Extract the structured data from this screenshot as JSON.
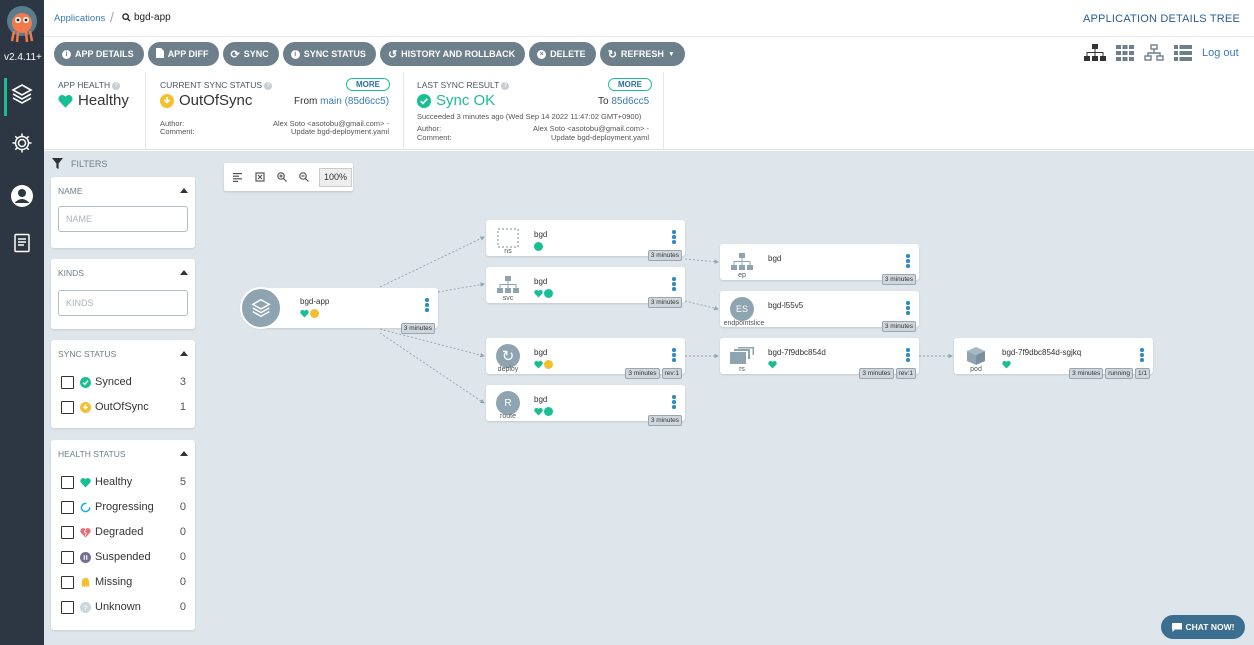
{
  "sidebar": {
    "version": "v2.4.11+"
  },
  "header": {
    "breadcrumb_root": "Applications",
    "breadcrumb_current": "bgd-app",
    "title": "APPLICATION DETAILS TREE"
  },
  "toolbar": {
    "buttons": [
      {
        "label": "APP DETAILS",
        "icon": "info-icon"
      },
      {
        "label": "APP DIFF",
        "icon": "file-icon"
      },
      {
        "label": "SYNC",
        "icon": "sync-icon"
      },
      {
        "label": "SYNC STATUS",
        "icon": "info-icon"
      },
      {
        "label": "HISTORY AND ROLLBACK",
        "icon": "history-icon"
      },
      {
        "label": "DELETE",
        "icon": "delete-icon"
      },
      {
        "label": "REFRESH",
        "icon": "refresh-icon"
      }
    ],
    "logout": "Log out"
  },
  "status": {
    "health": {
      "label": "APP HEALTH",
      "value": "Healthy"
    },
    "sync": {
      "label": "CURRENT SYNC STATUS",
      "value": "OutOfSync",
      "more": "MORE",
      "from_prefix": "From",
      "from_link": "main (85d6cc5)",
      "author_label": "Author:",
      "author": "Alex Soto <asotobu@gmail.com> -",
      "comment_label": "Comment:",
      "comment": "Update bgd-deployment.yaml"
    },
    "last_sync": {
      "label": "LAST SYNC RESULT",
      "value": "Sync OK",
      "more": "MORE",
      "to_prefix": "To",
      "to_link": "85d6cc5",
      "succeeded": "Succeeded 3 minutes ago (Wed Sep 14 2022 11:47:02 GMT+0900)",
      "author_label": "Author:",
      "author": "Alex Soto <asotobu@gmail.com> -",
      "comment_label": "Comment:",
      "comment": "Update bgd-deployment.yaml"
    }
  },
  "filters": {
    "title": "FILTERS",
    "name": {
      "title": "NAME",
      "placeholder": "NAME"
    },
    "kinds": {
      "title": "KINDS",
      "placeholder": "KINDS"
    },
    "sync_status": {
      "title": "SYNC STATUS",
      "items": [
        {
          "label": "Synced",
          "count": "3"
        },
        {
          "label": "OutOfSync",
          "count": "1"
        }
      ]
    },
    "health_status": {
      "title": "HEALTH STATUS",
      "items": [
        {
          "label": "Healthy",
          "count": "5"
        },
        {
          "label": "Progressing",
          "count": "0"
        },
        {
          "label": "Degraded",
          "count": "0"
        },
        {
          "label": "Suspended",
          "count": "0"
        },
        {
          "label": "Missing",
          "count": "0"
        },
        {
          "label": "Unknown",
          "count": "0"
        }
      ]
    }
  },
  "graph": {
    "zoom": "100%",
    "nodes": {
      "app": {
        "name": "bgd-app",
        "kind": "",
        "tags": [
          "3 minutes"
        ]
      },
      "ns": {
        "name": "bgd",
        "kind": "ns",
        "tags": [
          "3 minutes"
        ]
      },
      "svc": {
        "name": "bgd",
        "kind": "svc",
        "tags": [
          "3 minutes"
        ]
      },
      "deploy": {
        "name": "bgd",
        "kind": "deploy",
        "tags": [
          "3 minutes",
          "rev:1"
        ]
      },
      "route": {
        "name": "bgd",
        "kind": "route",
        "icon_letter": "R",
        "tags": [
          "3 minutes"
        ]
      },
      "ep": {
        "name": "bgd",
        "kind": "ep",
        "tags": [
          "3 minutes"
        ]
      },
      "epslice": {
        "name": "bgd-l55v5",
        "kind": "endpointslice",
        "icon_letter": "ES",
        "tags": [
          "3 minutes"
        ]
      },
      "rs": {
        "name": "bgd-7f9dbc854d",
        "kind": "rs",
        "tags": [
          "3 minutes",
          "rev:1"
        ]
      },
      "pod": {
        "name": "bgd-7f9dbc854d-sgjkq",
        "kind": "pod",
        "tags": [
          "3 minutes",
          "running",
          "1/1"
        ]
      }
    }
  },
  "chat": {
    "label": "CHAT NOW!"
  },
  "colors": {
    "accent": "#18be94",
    "sidebar": "#2c3743",
    "button": "#6d7f8b",
    "link": "#3a7cb3",
    "warning": "#f4c030"
  }
}
